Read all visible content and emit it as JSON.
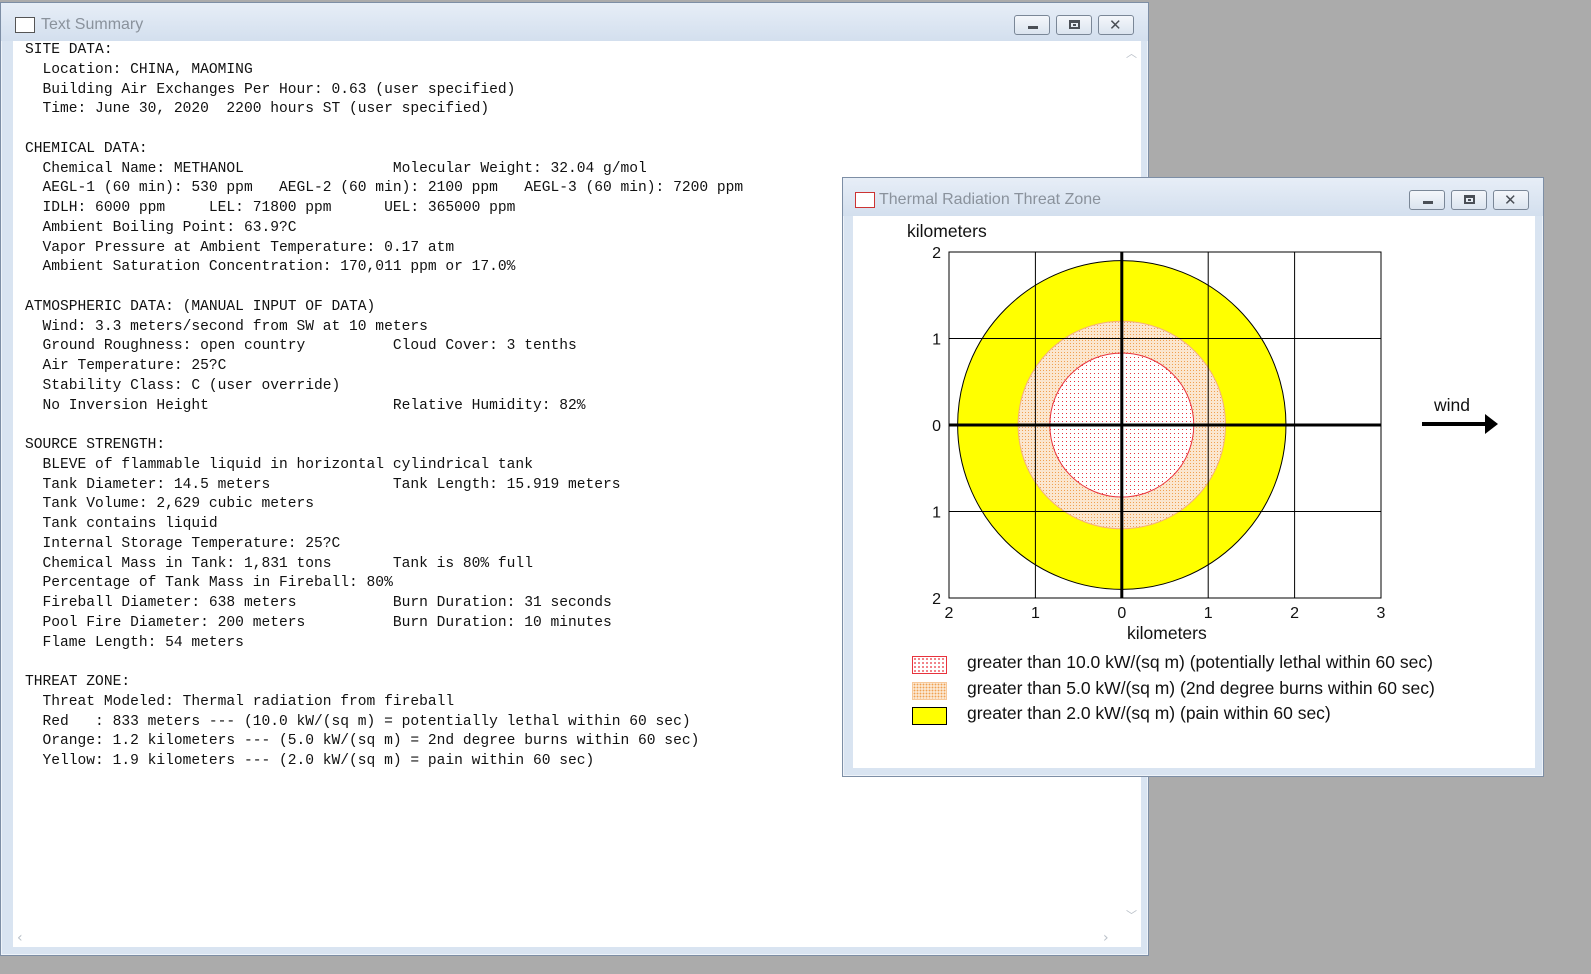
{
  "text_window": {
    "title": "Text Summary",
    "lines": [
      "SITE DATA:",
      "  Location: CHINA, MAOMING",
      "  Building Air Exchanges Per Hour: 0.63 (user specified)",
      "  Time: June 30, 2020  2200 hours ST (user specified)",
      "",
      "CHEMICAL DATA:",
      "  Chemical Name: METHANOL                 Molecular Weight: 32.04 g/mol",
      "  AEGL-1 (60 min): 530 ppm   AEGL-2 (60 min): 2100 ppm   AEGL-3 (60 min): 7200 ppm",
      "  IDLH: 6000 ppm     LEL: 71800 ppm      UEL: 365000 ppm",
      "  Ambient Boiling Point: 63.9?C",
      "  Vapor Pressure at Ambient Temperature: 0.17 atm",
      "  Ambient Saturation Concentration: 170,011 ppm or 17.0%",
      "",
      "ATMOSPHERIC DATA: (MANUAL INPUT OF DATA)",
      "  Wind: 3.3 meters/second from SW at 10 meters",
      "  Ground Roughness: open country          Cloud Cover: 3 tenths",
      "  Air Temperature: 25?C",
      "  Stability Class: C (user override)",
      "  No Inversion Height                     Relative Humidity: 82%",
      "",
      "SOURCE STRENGTH:",
      "  BLEVE of flammable liquid in horizontal cylindrical tank",
      "  Tank Diameter: 14.5 meters              Tank Length: 15.919 meters",
      "  Tank Volume: 2,629 cubic meters",
      "  Tank contains liquid",
      "  Internal Storage Temperature: 25?C",
      "  Chemical Mass in Tank: 1,831 tons       Tank is 80% full",
      "  Percentage of Tank Mass in Fireball: 80%",
      "  Fireball Diameter: 638 meters           Burn Duration: 31 seconds",
      "  Pool Fire Diameter: 200 meters          Burn Duration: 10 minutes",
      "  Flame Length: 54 meters",
      "",
      "THREAT ZONE:",
      "  Threat Modeled: Thermal radiation from fireball",
      "  Red   : 833 meters --- (10.0 kW/(sq m) = potentially lethal within 60 sec)",
      "  Orange: 1.2 kilometers --- (5.0 kW/(sq m) = 2nd degree burns within 60 sec)",
      "  Yellow: 1.9 kilometers --- (2.0 kW/(sq m) = pain within 60 sec)"
    ]
  },
  "threat_window": {
    "title": "Thermal Radiation Threat Zone",
    "y_axis_label": "kilometers",
    "x_axis_label": "kilometers",
    "x_ticks": [
      "2",
      "1",
      "0",
      "1",
      "2",
      "3"
    ],
    "y_ticks": [
      "2",
      "1",
      "0",
      "1",
      "2"
    ],
    "wind_label": "wind",
    "legend": [
      {
        "label": "greater than 10.0 kW/(sq m) (potentially lethal within 60 sec)",
        "color": "#e8323c",
        "pattern": "dotted-red"
      },
      {
        "label": "greater than 5.0 kW/(sq m) (2nd degree burns within 60 sec)",
        "color": "#f5a65b",
        "pattern": "dotted-orange"
      },
      {
        "label": "greater than 2.0 kW/(sq m) (pain within 60 sec)",
        "color": "#ffff00",
        "pattern": "solid-yellow"
      }
    ]
  },
  "chart_data": {
    "type": "threat-zone-map",
    "xlim": [
      -2,
      3
    ],
    "ylim": [
      -2,
      2
    ],
    "zones": [
      {
        "name": "yellow",
        "radius_km": 1.9,
        "color": "#ffff00"
      },
      {
        "name": "orange",
        "radius_km": 1.2,
        "color": "#f5a65b"
      },
      {
        "name": "red",
        "radius_km": 0.833,
        "color": "#e8323c"
      }
    ],
    "grid": true
  }
}
